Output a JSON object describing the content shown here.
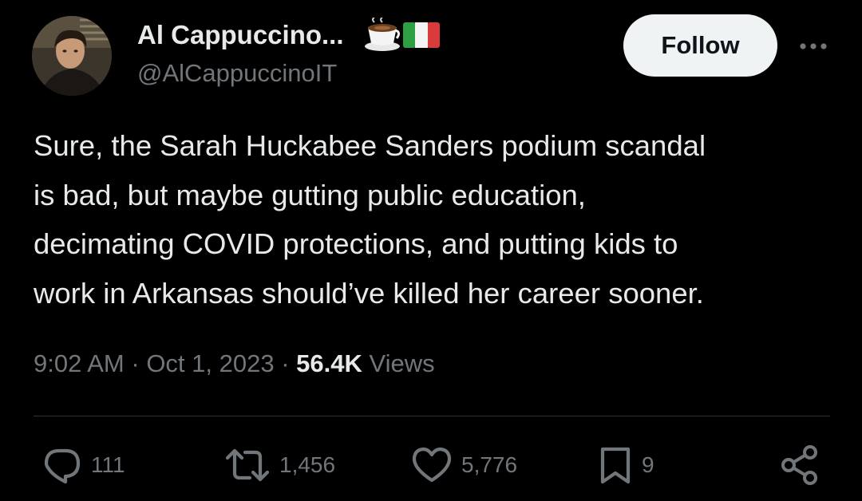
{
  "author": {
    "display_name": "Al Cappuccino...",
    "name_emojis": [
      "coffee-cup-icon",
      "italian-flag-icon"
    ],
    "handle": "@AlCappuccinoIT"
  },
  "follow_label": "Follow",
  "more_label": "More",
  "tweet": {
    "text": "Sure, the Sarah Huckabee Sanders podium scandal\nis bad, but maybe gutting public education,\ndecimating COVID protections, and putting kids to\nwork in Arkansas should’ve killed her career sooner."
  },
  "meta": {
    "time": "9:02 AM",
    "separator": " · ",
    "date": "Oct 1, 2023",
    "views_count": "56.4K",
    "views_label": "Views"
  },
  "actions": {
    "replies": "111",
    "reposts": "1,456",
    "likes": "5,776",
    "bookmarks": "9"
  },
  "colors": {
    "background": "#000000",
    "primary_text": "#e7e9ea",
    "secondary_text": "#71767b",
    "divider": "#2f3336",
    "follow_bg": "#eff3f4",
    "follow_text": "#0f1419"
  }
}
